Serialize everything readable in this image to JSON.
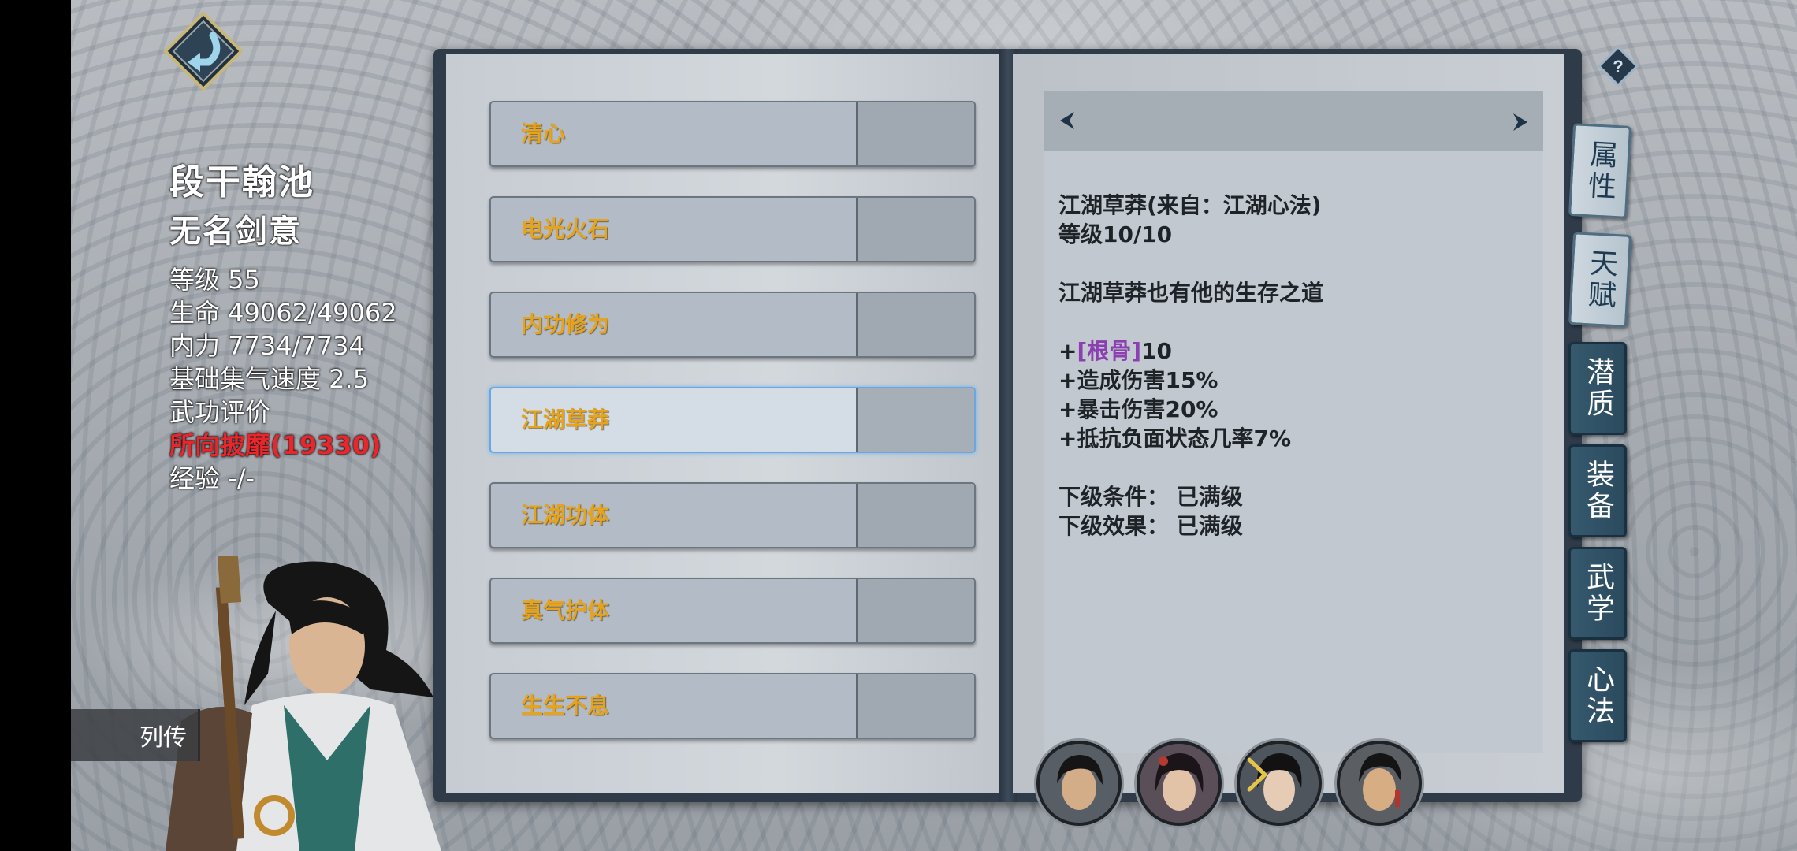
{
  "character": {
    "name": "段干翰池",
    "title": "无名剑意",
    "level": "等级 55",
    "hp": "生命 49062/49062",
    "mp": "内力 7734/7734",
    "qi_speed": "基础集气速度 2.5",
    "martial_rating_label": "武功评价",
    "martial_rating_value": "所向披靡(19330)",
    "exp": "经验 -/-"
  },
  "biography_button": "列传",
  "skills": [
    {
      "name": "清心"
    },
    {
      "name": "电光火石"
    },
    {
      "name": "内功修为"
    },
    {
      "name": "江湖草莽",
      "selected": true
    },
    {
      "name": "江湖功体"
    },
    {
      "name": "真气护体"
    },
    {
      "name": "生生不息"
    }
  ],
  "detail": {
    "title_line": "江湖草莽(来自：江湖心法)",
    "level_line": "等级10/10",
    "description": "江湖草莽也有他的生存之道",
    "bonus_attr_prefix": "+",
    "bonus_attr_name": "[根骨]",
    "bonus_attr_value": "10",
    "bonus_1": "+造成伤害15%",
    "bonus_2": "+暴击伤害20%",
    "bonus_3": "+抵抗负面状态几率7%",
    "next_condition": "下级条件： 已满级",
    "next_effect": "下级效果： 已满级"
  },
  "tabs": [
    "属性",
    "天赋",
    "潜质",
    "装备",
    "武学",
    "心法"
  ],
  "colors": {
    "skill_label": "#e6a31e",
    "rating_red": "#e8262b",
    "attr_purple": "#8b3fb0",
    "tab_teal": "#2b4a5e",
    "selected_border": "#6ba6dd"
  },
  "icons": [
    "back-arrow-icon",
    "help-icon",
    "prev-arrow-icon",
    "next-arrow-icon",
    "chevron-right-icon"
  ]
}
